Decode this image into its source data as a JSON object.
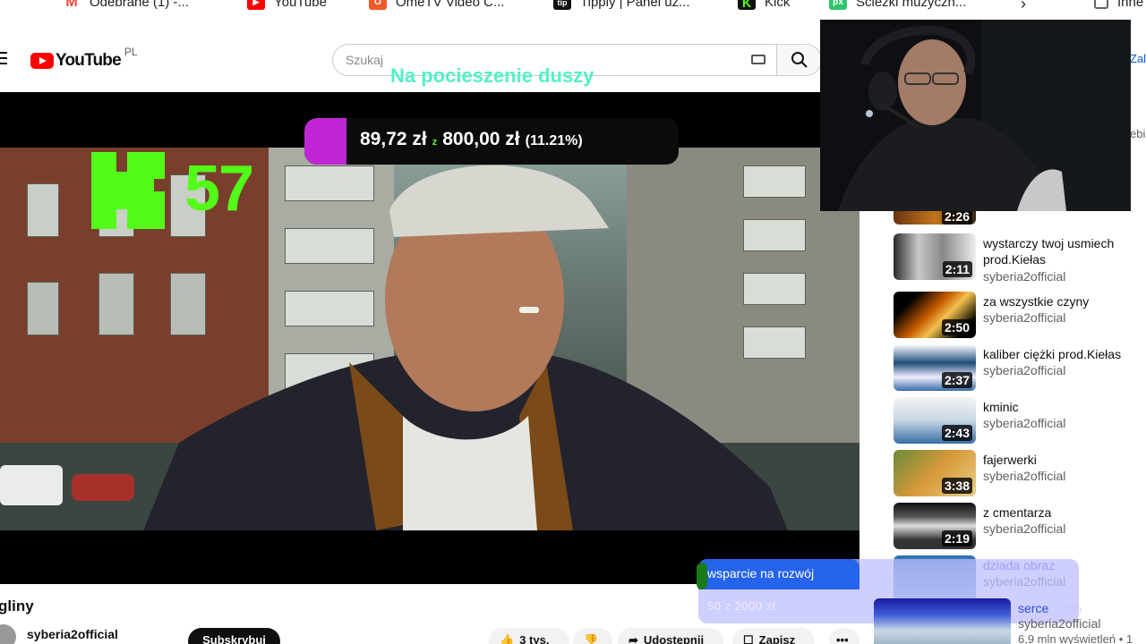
{
  "bookmarks": [
    {
      "label": "Odebrane (1) -...",
      "icon": "gmail-icon",
      "color": "#ea4335",
      "glyph": "M"
    },
    {
      "label": "YouTube",
      "icon": "youtube-icon",
      "color": "#ff0000",
      "glyph": "▶"
    },
    {
      "label": "OmeTV Video C...",
      "icon": "ometv-icon",
      "color": "#f05a28",
      "glyph": "O"
    },
    {
      "label": "Tipply | Panel uż...",
      "icon": "tipply-icon",
      "color": "#111111",
      "glyph": "tip"
    },
    {
      "label": "Kick",
      "icon": "kick-icon",
      "color": "#111111",
      "glyph": "K"
    },
    {
      "label": "Ścieżki muzyczn...",
      "icon": "pixabay-icon",
      "color": "#2ec66d",
      "glyph": "px"
    },
    {
      "label": "Inne",
      "icon": "folder-icon",
      "color": "#5f6368",
      "glyph": ""
    }
  ],
  "header": {
    "logo_text": "YouTube",
    "region": "PL",
    "search_placeholder": "Szukaj"
  },
  "overlay": {
    "kick_count": "57",
    "goal_title": "Na pocieszenie duszy",
    "goal_current": "89,72 zł",
    "goal_sep": "z",
    "goal_target": "800,00 zł",
    "goal_percent": "(11.21%)",
    "goal_fraction": 0.1121,
    "accent": "#53fc18",
    "fill_color": "#c026d3"
  },
  "video": {
    "title": "gliny",
    "channel": "syberia2official",
    "subscribe_label": "Subskrybuj",
    "likes_label": "3 tys.",
    "share_label": "Udostępnij",
    "save_label": "Zapisz",
    "more_label": "•••"
  },
  "recommendations": [
    {
      "title": "wystarczy twoj usmiech prod.Kiełas",
      "channel": "syberia2official",
      "duration": "2:11"
    },
    {
      "title": "za wszystkie czyny",
      "channel": "syberia2official",
      "duration": "2:50"
    },
    {
      "title": "kaliber ciężki prod.Kiełas",
      "channel": "syberia2official",
      "duration": "2:37"
    },
    {
      "title": "kminic",
      "channel": "syberia2official",
      "duration": "2:43"
    },
    {
      "title": "fajerwerki",
      "channel": "syberia2official",
      "duration": "3:38"
    },
    {
      "title": "z cmentarza",
      "channel": "syberia2official",
      "duration": "2:19"
    },
    {
      "title": "dziada obraz",
      "channel": "syberia2official",
      "duration": ""
    },
    {
      "title": "serce",
      "channel": "syberia2official",
      "duration": ""
    }
  ],
  "partial_first_duration": "2:26",
  "last_views": "6,9 mln wyświetleń • 1",
  "edge_texts": {
    "top_right": "Zal",
    "mid_right": "ebi"
  },
  "support_goal": {
    "title": "wsparcie na rozwój",
    "amount": "50 z 2000 zł",
    "percent": "3%"
  }
}
